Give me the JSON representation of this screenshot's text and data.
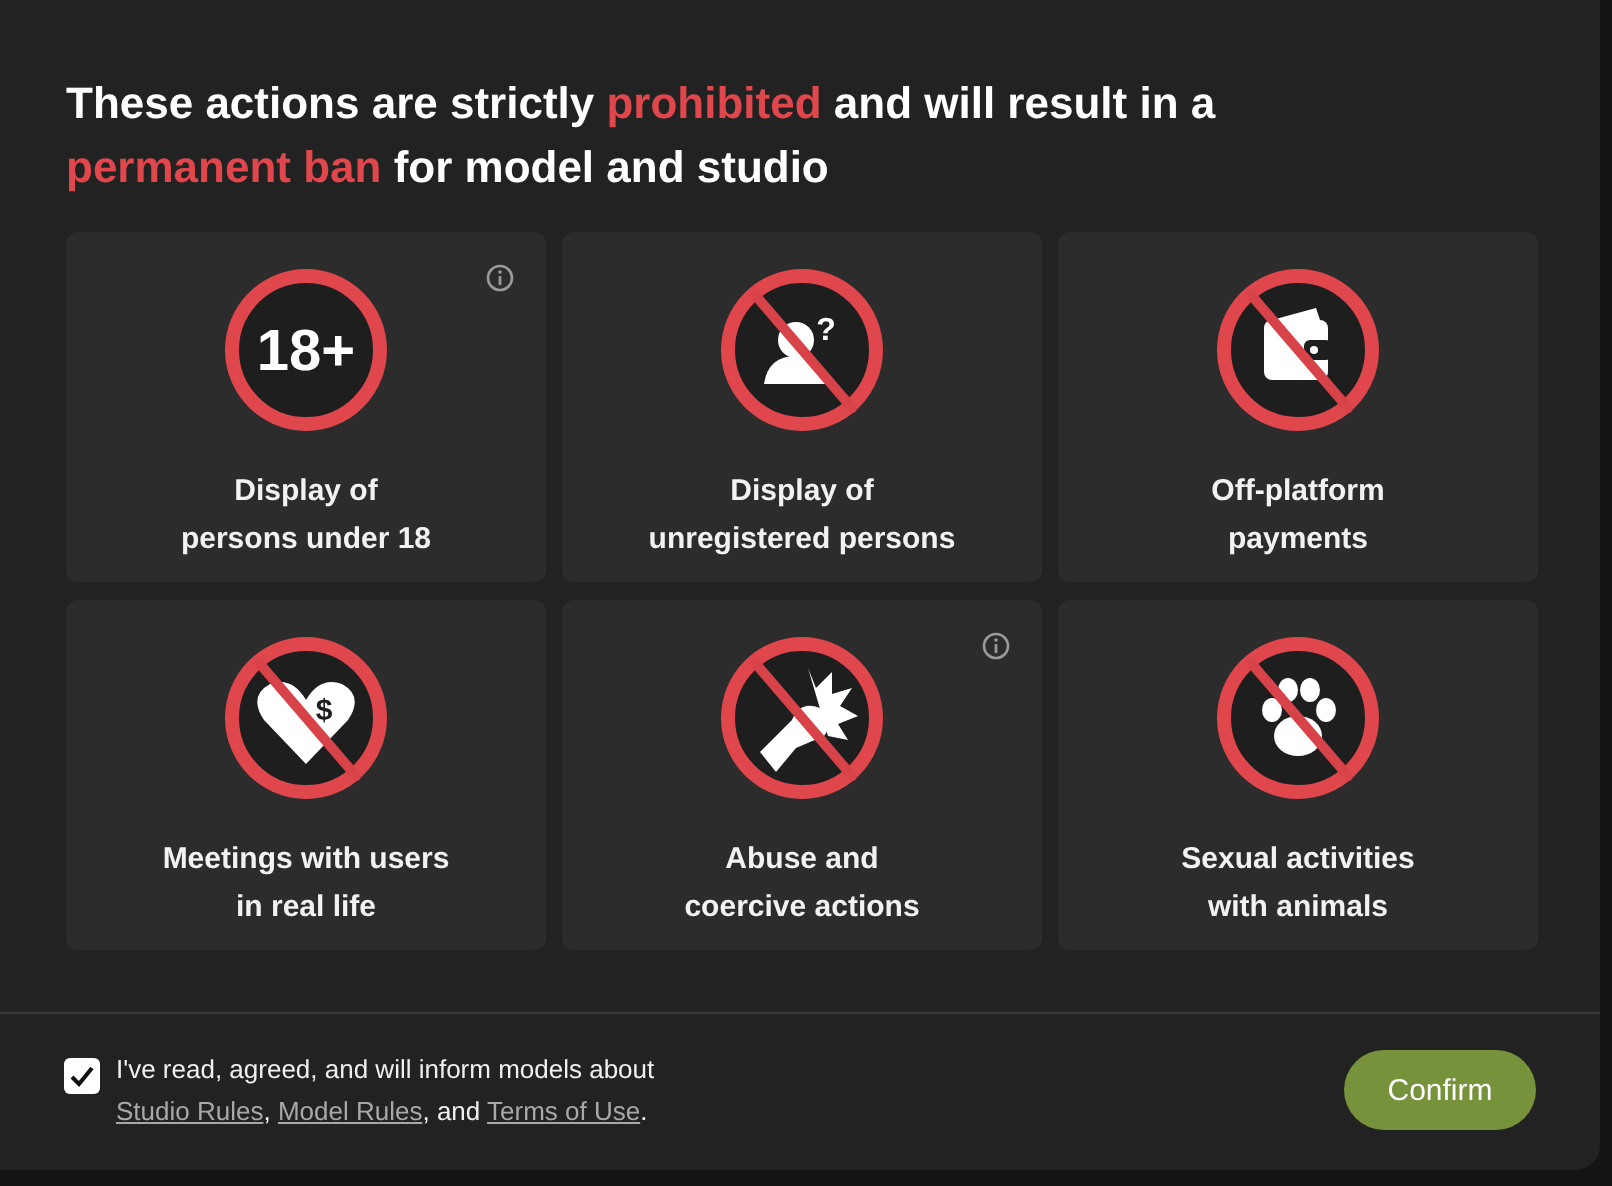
{
  "title": [
    {
      "text": "These actions are strictly ",
      "highlight": false
    },
    {
      "text": "prohibited",
      "highlight": true
    },
    {
      "text": " and will result in a ",
      "highlight": false
    },
    {
      "text": "permanent ban",
      "highlight": true
    },
    {
      "text": " for model and studio",
      "highlight": false
    }
  ],
  "cards": [
    {
      "kind": "age",
      "icon_text": "18+",
      "info": true,
      "lines": [
        "Display of",
        "persons under 18"
      ]
    },
    {
      "kind": "unregistered",
      "icon_text": "?",
      "info": false,
      "lines": [
        "Display of",
        "unregistered persons"
      ]
    },
    {
      "kind": "wallet",
      "info": false,
      "lines": [
        "Off-platform",
        "payments"
      ]
    },
    {
      "kind": "money-heart",
      "icon_text": "$",
      "info": false,
      "lines": [
        "Meetings with users",
        "in real life"
      ]
    },
    {
      "kind": "abuse",
      "info": true,
      "lines": [
        "Abuse and",
        "coercive actions"
      ]
    },
    {
      "kind": "paw",
      "info": false,
      "lines": [
        "Sexual activities",
        "with animals"
      ]
    }
  ],
  "agreement": {
    "checked": true,
    "parts": [
      {
        "text": "I've read, agreed, and will inform models about ",
        "link": false
      },
      {
        "text": "Studio Rules",
        "link": true
      },
      {
        "text": ", ",
        "link": false
      },
      {
        "text": "Model Rules",
        "link": true
      },
      {
        "text": ", and ",
        "link": false
      },
      {
        "text": "Terms of Use",
        "link": true
      },
      {
        "text": ".",
        "link": false
      }
    ]
  },
  "confirm_button": "Confirm"
}
